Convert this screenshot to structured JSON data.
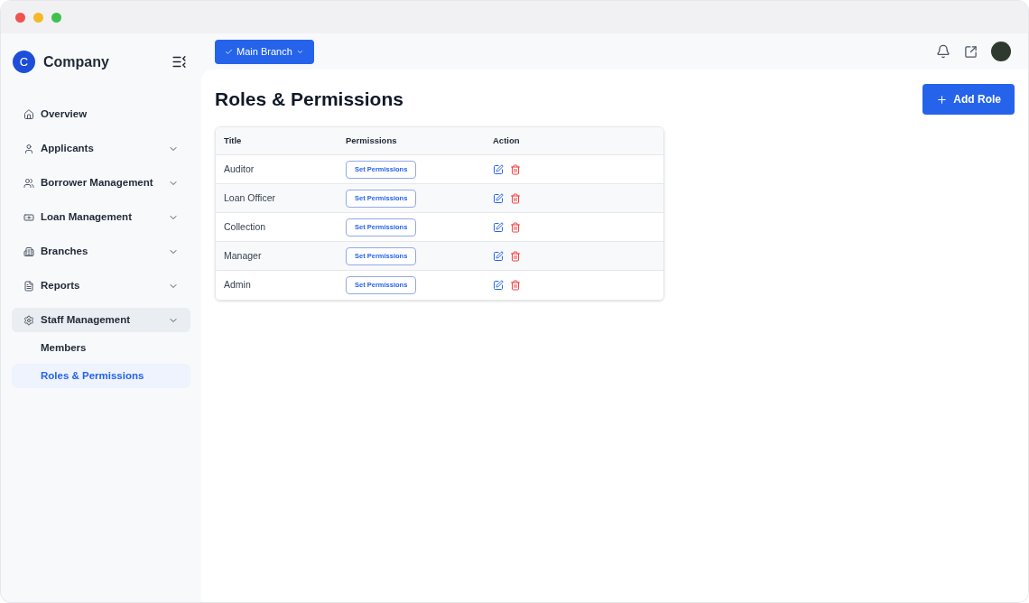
{
  "brand": {
    "initial": "C",
    "name": "Company"
  },
  "sidebar": {
    "items": [
      {
        "label": "Overview",
        "kind": "home",
        "has_submenu": false,
        "selected": false
      },
      {
        "label": "Applicants",
        "kind": "user",
        "has_submenu": true,
        "selected": false
      },
      {
        "label": "Borrower Management",
        "kind": "users",
        "has_submenu": true,
        "selected": false
      },
      {
        "label": "Loan Management",
        "kind": "money",
        "has_submenu": true,
        "selected": false
      },
      {
        "label": "Branches",
        "kind": "building",
        "has_submenu": true,
        "selected": false
      },
      {
        "label": "Reports",
        "kind": "report",
        "has_submenu": true,
        "selected": false
      },
      {
        "label": "Staff Management",
        "kind": "gear",
        "has_submenu": true,
        "selected": true,
        "children": [
          {
            "label": "Members",
            "selected": false
          },
          {
            "label": "Roles & Permissions",
            "selected": true
          }
        ]
      }
    ]
  },
  "topbar": {
    "branch_button": "Main Branch"
  },
  "page": {
    "title": "Roles & Permissions",
    "add_button": "Add Role"
  },
  "table": {
    "columns": [
      "Title",
      "Permissions",
      "Action"
    ],
    "rows": [
      {
        "title": "Auditor",
        "permissions_button": "Set Permissions"
      },
      {
        "title": "Loan Officer",
        "permissions_button": "Set Permissions"
      },
      {
        "title": "Collection",
        "permissions_button": "Set Permissions"
      },
      {
        "title": "Manager",
        "permissions_button": "Set Permissions"
      },
      {
        "title": "Admin",
        "permissions_button": "Set Permissions"
      }
    ]
  }
}
